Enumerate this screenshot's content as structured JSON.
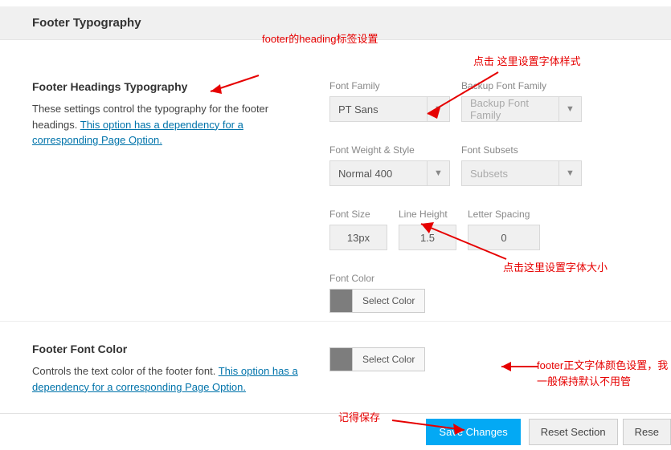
{
  "header": {
    "title": "Footer Typography"
  },
  "section1": {
    "heading": "Footer Headings Typography",
    "desc_prefix": "These settings control the typography for the footer headings. ",
    "desc_link": "This option has a dependency for a corresponding Page Option."
  },
  "labels": {
    "font_family": "Font Family",
    "backup_font_family": "Backup Font Family",
    "font_weight_style": "Font Weight & Style",
    "font_subsets": "Font Subsets",
    "font_size": "Font Size",
    "line_height": "Line Height",
    "letter_spacing": "Letter Spacing",
    "font_color": "Font Color",
    "select_color": "Select Color"
  },
  "values": {
    "font_family": "PT Sans",
    "backup_font_family": "Backup Font Family",
    "font_weight_style": "Normal 400",
    "font_subsets": "Subsets",
    "font_size": "13px",
    "line_height": "1.5",
    "letter_spacing": "0"
  },
  "section2": {
    "heading": "Footer Font Color",
    "desc_prefix": "Controls the text color of the footer font. ",
    "desc_link": "This option has a dependency for a corresponding Page Option."
  },
  "buttons": {
    "save": "Save Changes",
    "reset_section": "Reset Section",
    "reset_all": "Rese"
  },
  "annotations": {
    "a1": "footer的heading标签设置",
    "a2": "点击 这里设置字体样式",
    "a3": "点击这里设置字体大小",
    "a4": "footer正文字体颜色设置，我一般保持默认不用管",
    "a5": "记得保存"
  }
}
